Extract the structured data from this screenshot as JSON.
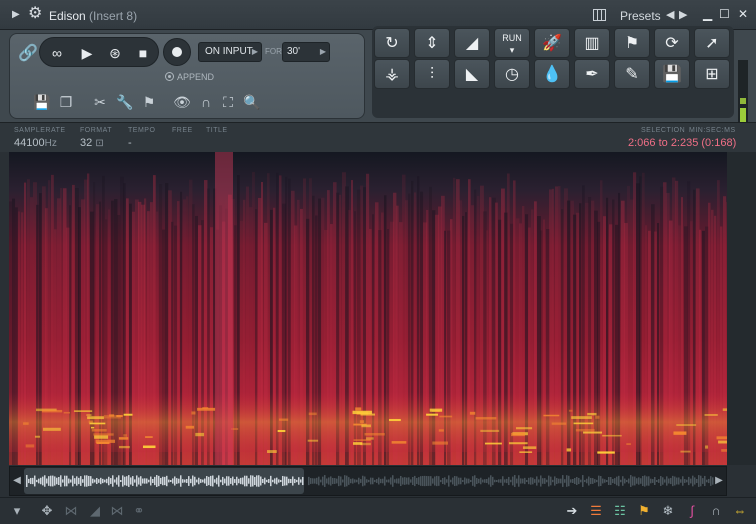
{
  "window": {
    "title": "Edison",
    "subtitle": "(Insert 8)",
    "presets_label": "Presets",
    "prev_icon": "triangle-left",
    "next_icon": "triangle-right",
    "minimize_icon": "minimize",
    "maximize_icon": "maximize",
    "close_icon": "close"
  },
  "toolbar": {
    "on_input_label": "ON INPUT",
    "for_label": "FOR",
    "for_value": "30'",
    "append_label": "APPEND",
    "logo_text": "edison"
  },
  "tool_buttons": {
    "run_label": "RUN"
  },
  "info": {
    "samplerate_label": "SAMPLERATE",
    "samplerate_value": "44100",
    "samplerate_unit": "Hz",
    "format_label": "FORMAT",
    "format_value": "32",
    "tempo_label": "TEMPO",
    "tempo_value": "-",
    "free_label": "FREE",
    "title_label": "TITLE",
    "selection_label": "SELECTION",
    "time_format_label": "MIN:SEC:MS",
    "selection_value": "2:066 to 2:235 (0:168)"
  },
  "colors": {
    "accent_selection": "#f06f86",
    "meter_green": "#9ccd3a",
    "spectrogram_hot": "#ffd23a",
    "spectrogram_warm": "#c0243a"
  }
}
